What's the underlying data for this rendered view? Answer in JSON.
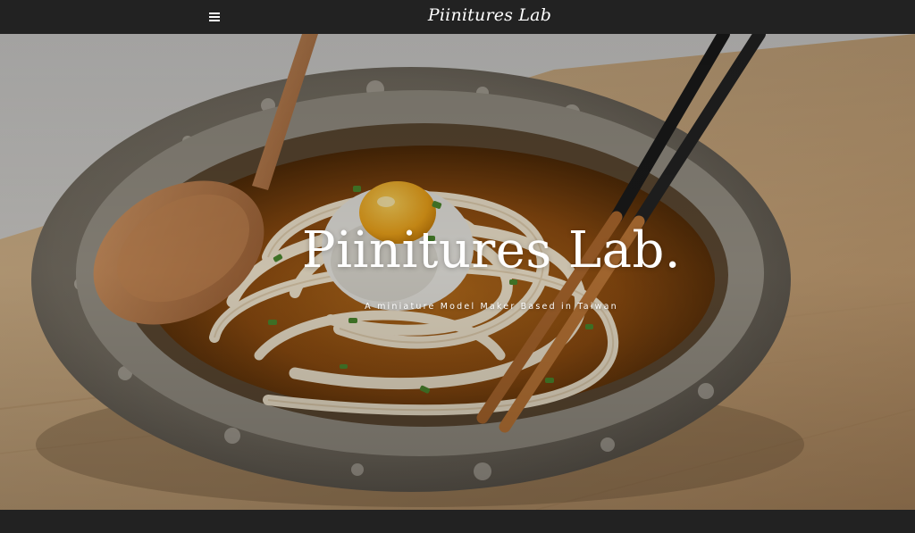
{
  "header": {
    "menu_icon": "hamburger-menu-icon",
    "site_title": "Piinitures Lab"
  },
  "hero": {
    "image_subject": "bowl of udon with raw egg, wooden spoon and chopsticks",
    "title": "Piinitures Lab.",
    "tagline": "A miniature Model Maker Based in Taiwan"
  },
  "colors": {
    "bar_background": "#222222",
    "text": "#ffffff"
  }
}
